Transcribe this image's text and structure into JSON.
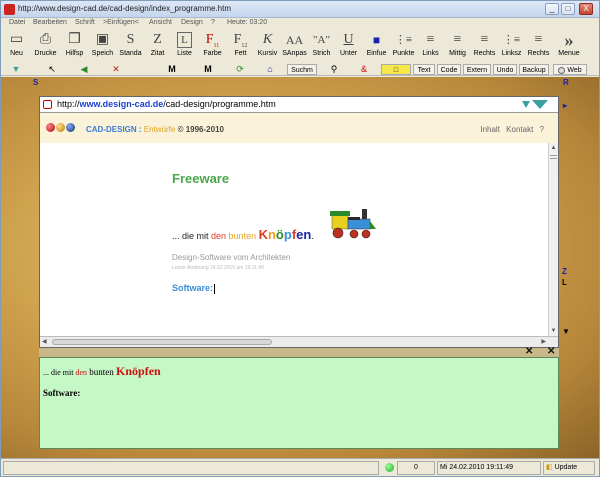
{
  "window": {
    "title": "http://www.design-cad.de/cad-design/index_programme.htm",
    "controls": [
      "_",
      "□",
      "X"
    ]
  },
  "menu": [
    "Datei",
    "Bearbeiten",
    "Schrift",
    ">Einfügen<",
    "Ansicht",
    "Design",
    "?",
    "Heute: 03:20"
  ],
  "toolbar": [
    {
      "label": "Neu",
      "icon": "new-file-icon",
      "glyph": "▭"
    },
    {
      "label": "Drucke",
      "icon": "printer-icon",
      "glyph": "⎙"
    },
    {
      "label": "Hilfsp",
      "icon": "windows-icon",
      "glyph": "❐"
    },
    {
      "label": "Speich",
      "icon": "save-icon",
      "glyph": "▣"
    },
    {
      "label": "Standa",
      "icon": "standard-font-icon",
      "glyph": "S"
    },
    {
      "label": "Zitat",
      "icon": "quote-icon",
      "glyph": "Z"
    },
    {
      "label": "Liste",
      "icon": "list-icon",
      "glyph": "L"
    },
    {
      "label": "Farbe",
      "icon": "color-icon",
      "glyph": "F",
      "sub": "11"
    },
    {
      "label": "Fett",
      "icon": "bold-icon",
      "glyph": "F",
      "sub": "12"
    },
    {
      "label": "Kursiv",
      "icon": "italic-icon",
      "glyph": "K"
    },
    {
      "label": "SAnpas",
      "icon": "font-size-icon",
      "glyph": "AA"
    },
    {
      "label": "Strich",
      "icon": "strike-icon",
      "glyph": "\"A\""
    },
    {
      "label": "Unter",
      "icon": "underline-icon",
      "glyph": "U"
    },
    {
      "label": "Einfue",
      "icon": "insert-icon",
      "glyph": "■"
    },
    {
      "label": "Punkte",
      "icon": "bullets-icon",
      "glyph": "⋮≡"
    },
    {
      "label": "Links",
      "icon": "align-left-icon",
      "glyph": "≡"
    },
    {
      "label": "Mittig",
      "icon": "align-center-icon",
      "glyph": "≡"
    },
    {
      "label": "Rechts",
      "icon": "align-right-icon",
      "glyph": "≡"
    },
    {
      "label": "Linksz",
      "icon": "indent-left-icon",
      "glyph": "⋮≡"
    },
    {
      "label": "Rechts",
      "icon": "indent-right-icon",
      "glyph": "≡"
    },
    {
      "label": "Menue",
      "icon": "more-icon",
      "glyph": "»"
    }
  ],
  "toolbar2": {
    "buttons": [
      "Suchm",
      "Text",
      "Code",
      "Extern",
      "Undo",
      "Backup",
      "Web"
    ]
  },
  "browser": {
    "url_prefix": "http://",
    "url_host": "www.design-cad.de",
    "url_path": "/cad-design/programme.htm",
    "brand": "CAD-DESIGN",
    "brand_entwurfe": "Entwürfe",
    "brand_copy": "© 1996-2010",
    "nav": [
      "Inhalt",
      "Kontakt",
      "?"
    ],
    "freeware": "Freeware",
    "tagline": {
      "p1": "... die mit ",
      "den": "den",
      "bunten": " bunten ",
      "k1": "K",
      "k2": "n",
      "k3": "ö",
      "k4": "p",
      "k5": "f",
      "k6": "en",
      "end": "."
    },
    "design_software": "Design-Software vom Architekten",
    "last_update": "Letzte Änderung 24.02.2010 am 19:11:49",
    "software": "Software:"
  },
  "editor": {
    "line1_p1": "... die mit ",
    "line1_den": "den",
    "line1_bunten": " bunten ",
    "line1_knopfen": "Knöpfen",
    "line2": "Software:"
  },
  "side_markers": {
    "left": "S",
    "right_top": "R",
    "right_z": "Z",
    "right_l": "L"
  },
  "status": {
    "count": "0",
    "datetime": "Mi 24.02.2010 19:11:49",
    "update": "Update"
  },
  "colors": {
    "editor_bg": "#c6f7c6",
    "header_bg": "#fbf3d9",
    "freeware": "#4aa84a",
    "software_link": "#3a8fd9"
  }
}
